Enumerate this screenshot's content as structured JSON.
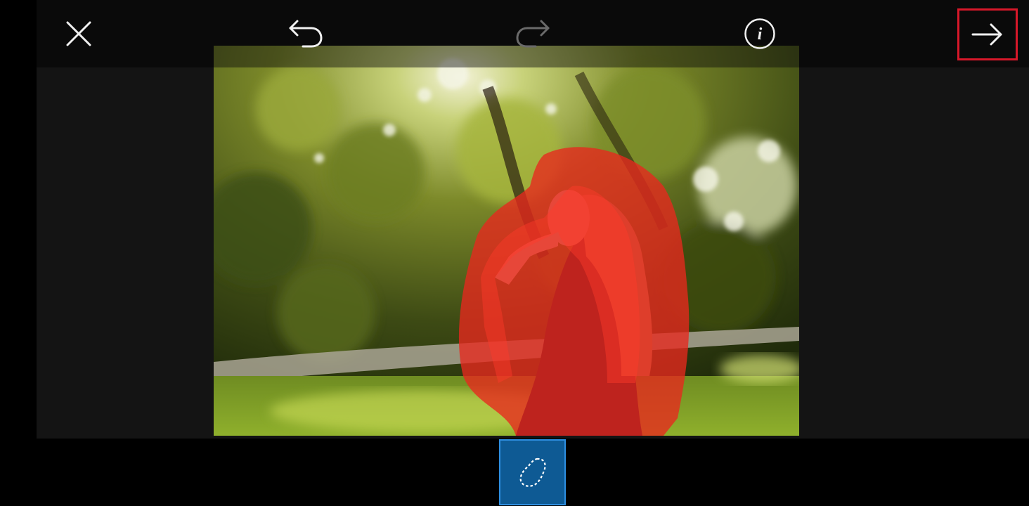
{
  "toolbar": {
    "close": {
      "icon": "close-icon"
    },
    "undo": {
      "icon": "undo-icon",
      "enabled": true
    },
    "redo": {
      "icon": "redo-icon",
      "enabled": false
    },
    "info": {
      "icon": "info-icon",
      "glyph": "i"
    },
    "next": {
      "icon": "arrow-right-icon",
      "highlighted": true
    }
  },
  "canvas": {
    "image": "photo-woman-praying-in-park",
    "mask_color": "#e8281e"
  },
  "tools": [
    {
      "icon": "lasso-select-icon",
      "selected": true
    }
  ],
  "colors": {
    "accent": "#0e5a94",
    "accent_border": "#2e8ee0",
    "highlight": "#d8182a",
    "toolbar_bg": "#0a0a0a",
    "workspace_bg": "#141414"
  }
}
